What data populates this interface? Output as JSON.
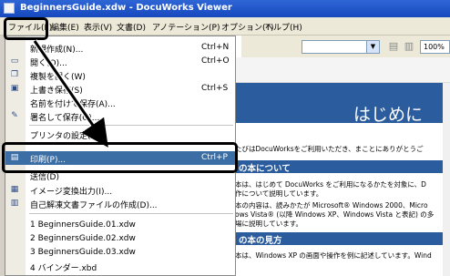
{
  "window": {
    "title": "BeginnersGuide.xdw - DocuWorks Viewer"
  },
  "menubar": {
    "items": [
      "ファイル(F)",
      "編集(E)",
      "表示(V)",
      "文書(D)",
      "アノテーション(P)",
      "オプション(T)",
      "ヘルプ(H)"
    ]
  },
  "toolbar": {
    "zoom_value": "100%"
  },
  "file_menu": {
    "items": [
      {
        "label": "新規作成(N)...",
        "shortcut": "Ctrl+N",
        "icon": "new-icon"
      },
      {
        "label": "開く(O)...",
        "shortcut": "Ctrl+O",
        "icon": "open-icon"
      },
      {
        "label": "複製を開く(W)",
        "shortcut": "",
        "icon": "duplicate-icon"
      },
      {
        "label": "上書き保存(S)",
        "shortcut": "Ctrl+S",
        "icon": "save-icon"
      },
      {
        "label": "名前を付けて保存(A)...",
        "shortcut": "",
        "icon": ""
      },
      {
        "label": "署名して保存(G)...",
        "shortcut": "",
        "icon": "sign-icon"
      },
      {
        "label": "プリンタの設定(R)...",
        "shortcut": "",
        "icon": ""
      },
      {
        "label": "印刷(P)...",
        "shortcut": "Ctrl+P",
        "icon": "print-icon",
        "highlighted": true
      },
      {
        "label": "送信(D)",
        "shortcut": "",
        "icon": ""
      },
      {
        "label": "イメージ変換出力(I)...",
        "shortcut": "",
        "icon": "image-export-icon"
      },
      {
        "label": "自己解凍文書ファイルの作成(D)...",
        "shortcut": "",
        "icon": "self-extract-icon"
      },
      {
        "label": "1 BeginnersGuide.01.xdw",
        "shortcut": "",
        "icon": ""
      },
      {
        "label": "2 BeginnersGuide.02.xdw",
        "shortcut": "",
        "icon": ""
      },
      {
        "label": "3 BeginnersGuide.03.xdw",
        "shortcut": "",
        "icon": ""
      },
      {
        "label": "4 バインダー.xbd",
        "shortcut": "",
        "icon": ""
      }
    ]
  },
  "document": {
    "heading": "はじめに",
    "intro": "たびはDocuWorksをご利用いただき、まことにありがとうご",
    "section1_title": "の本について",
    "section1_lines": [
      "本は、はじめて DocuWorks をご利用になるかたを対象に、D",
      "作について説明しています。",
      "本の内容は、読みかたが Microsoft® Windows 2000、Micro",
      "ows Vista® (以降 Windows XP、Windows Vista と表記) の多",
      "場に説明しています。"
    ],
    "section2_title": "の本の見方",
    "section2_lines": [
      "本は、Windows XP の画面や操作を例に記述しています。Wind"
    ]
  }
}
